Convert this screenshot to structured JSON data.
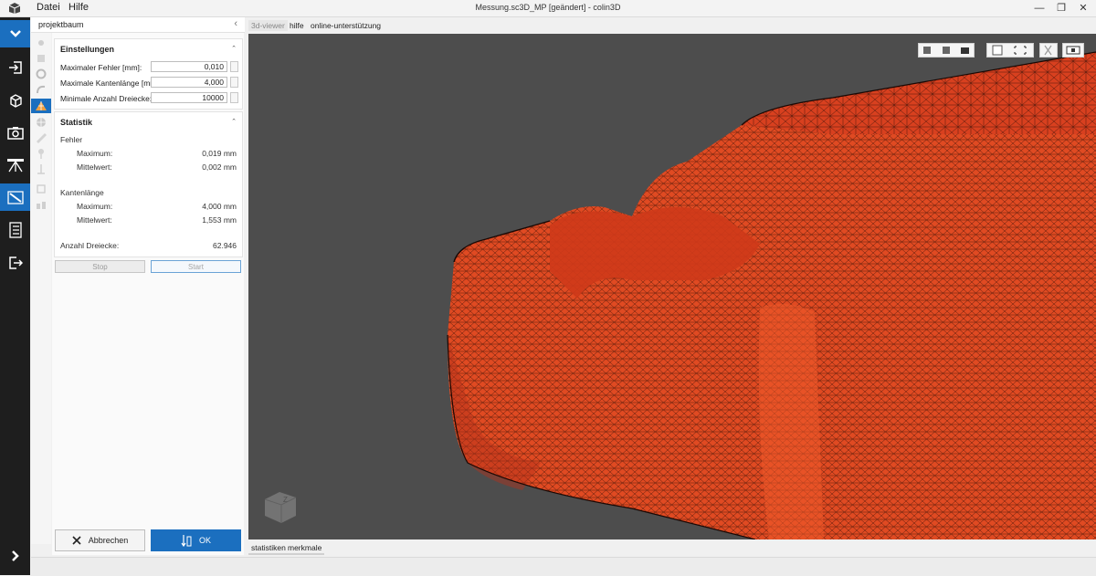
{
  "menu": {
    "file": "Datei",
    "help": "Hilfe"
  },
  "window": {
    "title": "Messung.sc3D_MP [geändert] - colin3D",
    "min": "—",
    "max": "❐",
    "close": "✕"
  },
  "panel": {
    "header": "projektbaum",
    "collapse": "‹",
    "settings": {
      "title": "Einstellungen",
      "collapse": "⌃",
      "max_error_label": "Maximaler Fehler [mm]:",
      "max_error_value": "0,010",
      "max_edge_label": "Maximale Kantenlänge [mn",
      "max_edge_value": "4,000",
      "min_triangles_label": "Minimale Anzahl Dreiecke:",
      "min_triangles_value": "10000"
    },
    "stats": {
      "title": "Statistik",
      "collapse": "⌃",
      "error_heading": "Fehler",
      "error_max_label": "Maximum:",
      "error_max_value": "0,019 mm",
      "error_mean_label": "Mittelwert:",
      "error_mean_value": "0,002 mm",
      "edge_heading": "Kantenlänge",
      "edge_max_label": "Maximum:",
      "edge_max_value": "4,000 mm",
      "edge_mean_label": "Mittelwert:",
      "edge_mean_value": "1,553 mm",
      "triangles_label": "Anzahl Dreiecke:",
      "triangles_value": "62.946"
    },
    "stop_label": "Stop",
    "start_label": "Start",
    "cancel_label": "Abbrechen",
    "ok_label": "OK"
  },
  "tabs_top": [
    "3d-viewer",
    "hilfe",
    "online-unterstützung"
  ],
  "tabs_bottom": [
    "statistiken",
    "merkmale"
  ],
  "colors": {
    "accent": "#1b6fbf",
    "mesh": "#d8401f",
    "viewer_bg": "#4d4d4d",
    "sidebar": "#1e1e1e"
  }
}
